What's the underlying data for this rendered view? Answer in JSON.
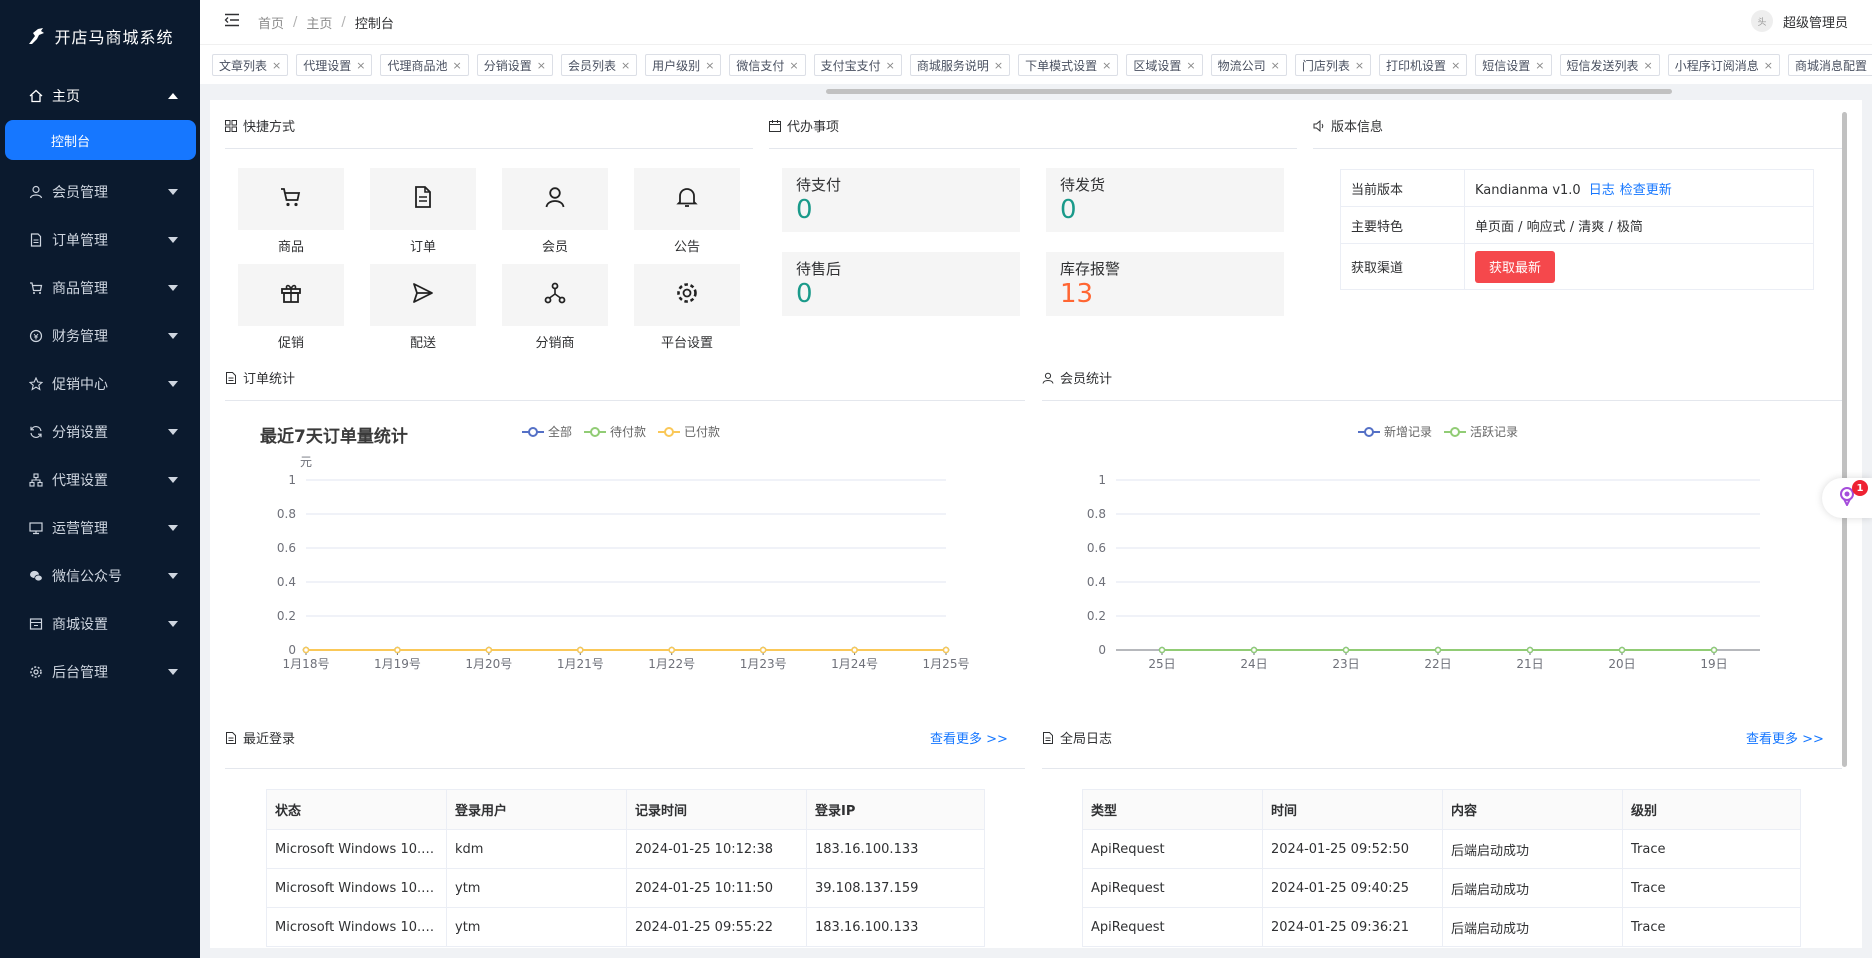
{
  "app": {
    "title": "开店马商城系统"
  },
  "sidebar": {
    "items": [
      {
        "label": "主页",
        "icon": "home-icon",
        "open": true
      },
      {
        "label": "会员管理",
        "icon": "user-icon"
      },
      {
        "label": "订单管理",
        "icon": "document-icon"
      },
      {
        "label": "商品管理",
        "icon": "cart-icon"
      },
      {
        "label": "财务管理",
        "icon": "finance-icon"
      },
      {
        "label": "促销中心",
        "icon": "star-icon"
      },
      {
        "label": "分销设置",
        "icon": "refresh-icon"
      },
      {
        "label": "代理设置",
        "icon": "org-icon"
      },
      {
        "label": "运营管理",
        "icon": "monitor-icon"
      },
      {
        "label": "微信公众号",
        "icon": "wechat-icon"
      },
      {
        "label": "商城设置",
        "icon": "store-icon"
      },
      {
        "label": "后台管理",
        "icon": "gear-icon"
      }
    ],
    "sub_active": "控制台"
  },
  "header": {
    "breadcrumb": [
      "首页",
      "主页",
      "控制台"
    ],
    "user_name": "超级管理员",
    "avatar_text": "头"
  },
  "tags": [
    "文章列表",
    "代理设置",
    "代理商品池",
    "分销设置",
    "会员列表",
    "用户级别",
    "微信支付",
    "支付宝支付",
    "商城服务说明",
    "下单模式设置",
    "区域设置",
    "物流公司",
    "门店列表",
    "打印机设置",
    "短信设置",
    "短信发送列表",
    "小程序订阅消息",
    "商城消息配置"
  ],
  "shortcuts": {
    "title": "快捷方式",
    "items": [
      {
        "label": "商品",
        "icon": "cart-icon"
      },
      {
        "label": "订单",
        "icon": "document-icon"
      },
      {
        "label": "会员",
        "icon": "user-icon"
      },
      {
        "label": "公告",
        "icon": "bell-icon"
      },
      {
        "label": "促销",
        "icon": "gift-icon"
      },
      {
        "label": "配送",
        "icon": "send-icon"
      },
      {
        "label": "分销商",
        "icon": "share-icon"
      },
      {
        "label": "平台设置",
        "icon": "gear-icon"
      }
    ]
  },
  "todo": {
    "title": "代办事项",
    "items": [
      {
        "label": "待支付",
        "value": "0"
      },
      {
        "label": "待发货",
        "value": "0"
      },
      {
        "label": "待售后",
        "value": "0"
      },
      {
        "label": "库存报警",
        "value": "13",
        "warn": true
      }
    ]
  },
  "version": {
    "title": "版本信息",
    "rows": {
      "current_label": "当前版本",
      "current_value": "Kandianma v1.0",
      "log_link": "日志",
      "update_link": "检查更新",
      "features_label": "主要特色",
      "features_value": "单页面 / 响应式 / 清爽 / 极简",
      "channel_label": "获取渠道",
      "channel_button": "获取最新"
    }
  },
  "order_stats": {
    "section_title": "订单统计"
  },
  "member_stats": {
    "section_title": "会员统计"
  },
  "chart_data": [
    {
      "type": "line",
      "title": "最近7天订单量统计",
      "ylabel": "元",
      "categories": [
        "1月18号",
        "1月19号",
        "1月20号",
        "1月21号",
        "1月22号",
        "1月23号",
        "1月24号",
        "1月25号"
      ],
      "series": [
        {
          "name": "全部",
          "color": "#5470c6",
          "values": [
            0,
            0,
            0,
            0,
            0,
            0,
            0,
            0
          ]
        },
        {
          "name": "待付款",
          "color": "#91cc75",
          "values": [
            0,
            0,
            0,
            0,
            0,
            0,
            0,
            0
          ]
        },
        {
          "name": "已付款",
          "color": "#fac858",
          "values": [
            0,
            0,
            0,
            0,
            0,
            0,
            0,
            0
          ]
        }
      ],
      "ylim": [
        0,
        1
      ],
      "yticks": [
        "0",
        "0.2",
        "0.4",
        "0.6",
        "0.8",
        "1"
      ],
      "grid": true,
      "legend": "top-center"
    },
    {
      "type": "line",
      "categories": [
        "25日",
        "24日",
        "23日",
        "22日",
        "21日",
        "20日",
        "19日"
      ],
      "series": [
        {
          "name": "新增记录",
          "color": "#5470c6",
          "values": [
            0,
            0,
            0,
            0,
            0,
            0,
            0
          ]
        },
        {
          "name": "活跃记录",
          "color": "#91cc75",
          "values": [
            0,
            0,
            0,
            0,
            0,
            0,
            0
          ]
        }
      ],
      "ylim": [
        0,
        1
      ],
      "yticks": [
        "0",
        "0.2",
        "0.4",
        "0.6",
        "0.8",
        "1"
      ],
      "grid": true,
      "legend": "top-center"
    }
  ],
  "recent_login": {
    "title": "最近登录",
    "more": "查看更多 >>",
    "columns": [
      "状态",
      "登录用户",
      "记录时间",
      "登录IP"
    ],
    "rows": [
      [
        "Microsoft Windows 10.0....",
        "kdm",
        "2024-01-25 10:12:38",
        "183.16.100.133"
      ],
      [
        "Microsoft Windows 10.0....",
        "ytm",
        "2024-01-25 10:11:50",
        "39.108.137.159"
      ],
      [
        "Microsoft Windows 10.0....",
        "ytm",
        "2024-01-25 09:55:22",
        "183.16.100.133"
      ]
    ]
  },
  "global_log": {
    "title": "全局日志",
    "more": "查看更多 >>",
    "columns": [
      "类型",
      "时间",
      "内容",
      "级别"
    ],
    "rows": [
      [
        "ApiRequest",
        "2024-01-25 09:52:50",
        "后端启动成功",
        "Trace"
      ],
      [
        "ApiRequest",
        "2024-01-25 09:40:25",
        "后端启动成功",
        "Trace"
      ],
      [
        "ApiRequest",
        "2024-01-25 09:36:21",
        "后端启动成功",
        "Trace"
      ]
    ]
  },
  "float_widget": {
    "badge": "1"
  },
  "colors": {
    "sidebar_bg": "#0b1a2e",
    "accent": "#1677ff",
    "danger": "#f5484c",
    "todo_value": "#1a9a8a",
    "warn_value": "#ff6633"
  }
}
